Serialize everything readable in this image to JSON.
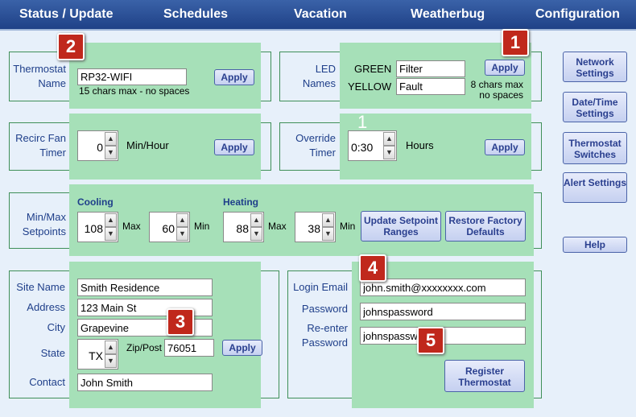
{
  "nav": {
    "status": "Status / Update",
    "schedules": "Schedules",
    "vacation": "Vacation",
    "weatherbug": "Weatherbug",
    "configuration": "Configuration"
  },
  "thermostat_name": {
    "label": "Thermostat Name",
    "value": "RP32-WIFI",
    "hint": "15 chars max - no spaces",
    "apply": "Apply"
  },
  "led": {
    "label": "LED Names",
    "green_label": "GREEN",
    "green_value": "Filter",
    "yellow_label": "YELLOW",
    "yellow_value": "Fault",
    "hint_line1": "8 chars max",
    "hint_line2": "no spaces",
    "apply": "Apply"
  },
  "recirc": {
    "label": "Recirc Fan Timer",
    "value": "0",
    "unit": "Min/Hour",
    "apply": "Apply"
  },
  "override": {
    "label": "Override Timer",
    "value": "0:30",
    "unit": "Hours",
    "apply": "Apply",
    "marker": "1"
  },
  "setpoints": {
    "label": "Min/Max Setpoints",
    "cooling_title": "Cooling",
    "heating_title": "Heating",
    "cool_max": "108",
    "cool_max_label": "Max",
    "cool_min": "60",
    "cool_min_label": "Min",
    "heat_max": "88",
    "heat_max_label": "Max",
    "heat_min": "38",
    "heat_min_label": "Min",
    "update_button": "Update Setpoint Ranges",
    "restore_button": "Restore Factory Defaults"
  },
  "site": {
    "site_name_label": "Site Name",
    "site_name": "Smith Residence",
    "address_label": "Address",
    "address": "123 Main St",
    "city_label": "City",
    "city": "Grapevine",
    "state_label": "State",
    "state": "TX",
    "zip_label": "Zip/Post",
    "zip": "76051",
    "contact_label": "Contact",
    "contact": "John Smith",
    "apply": "Apply"
  },
  "login": {
    "email_label": "Login Email",
    "email": "john.smith@xxxxxxxx.com",
    "password_label": "Password",
    "password": "johnspassword",
    "reenter_label": "Re-enter Password",
    "reenter": "johnspassword",
    "register_button": "Register Thermostat"
  },
  "sidebar": {
    "network": "Network Settings",
    "datetime": "Date/Time Settings",
    "switches": "Thermostat Switches",
    "alert": "Alert Settings",
    "help": "Help"
  },
  "badges": {
    "b1": "1",
    "b2": "2",
    "b3": "3",
    "b4": "4",
    "b5": "5",
    "color": "#c0281c"
  }
}
